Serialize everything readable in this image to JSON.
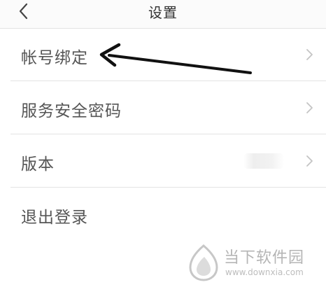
{
  "header": {
    "title": "设置",
    "back_icon": "back-chevron-icon"
  },
  "settings": {
    "items": [
      {
        "label": "帐号绑定",
        "chevron": "chevron-right-icon"
      },
      {
        "label": "服务安全密码",
        "chevron": "chevron-right-icon"
      },
      {
        "label": "版本",
        "value": "",
        "chevron": "chevron-right-icon"
      },
      {
        "label": "退出登录"
      }
    ]
  },
  "annotation": {
    "arrow_color": "#111111"
  },
  "watermark": {
    "name": "当下软件园",
    "url": "www.downxia.com"
  },
  "colors": {
    "divider": "#e3e3e3",
    "text": "#555555",
    "chevron": "#c4c4c4",
    "watermark": "#b5b5b5"
  }
}
